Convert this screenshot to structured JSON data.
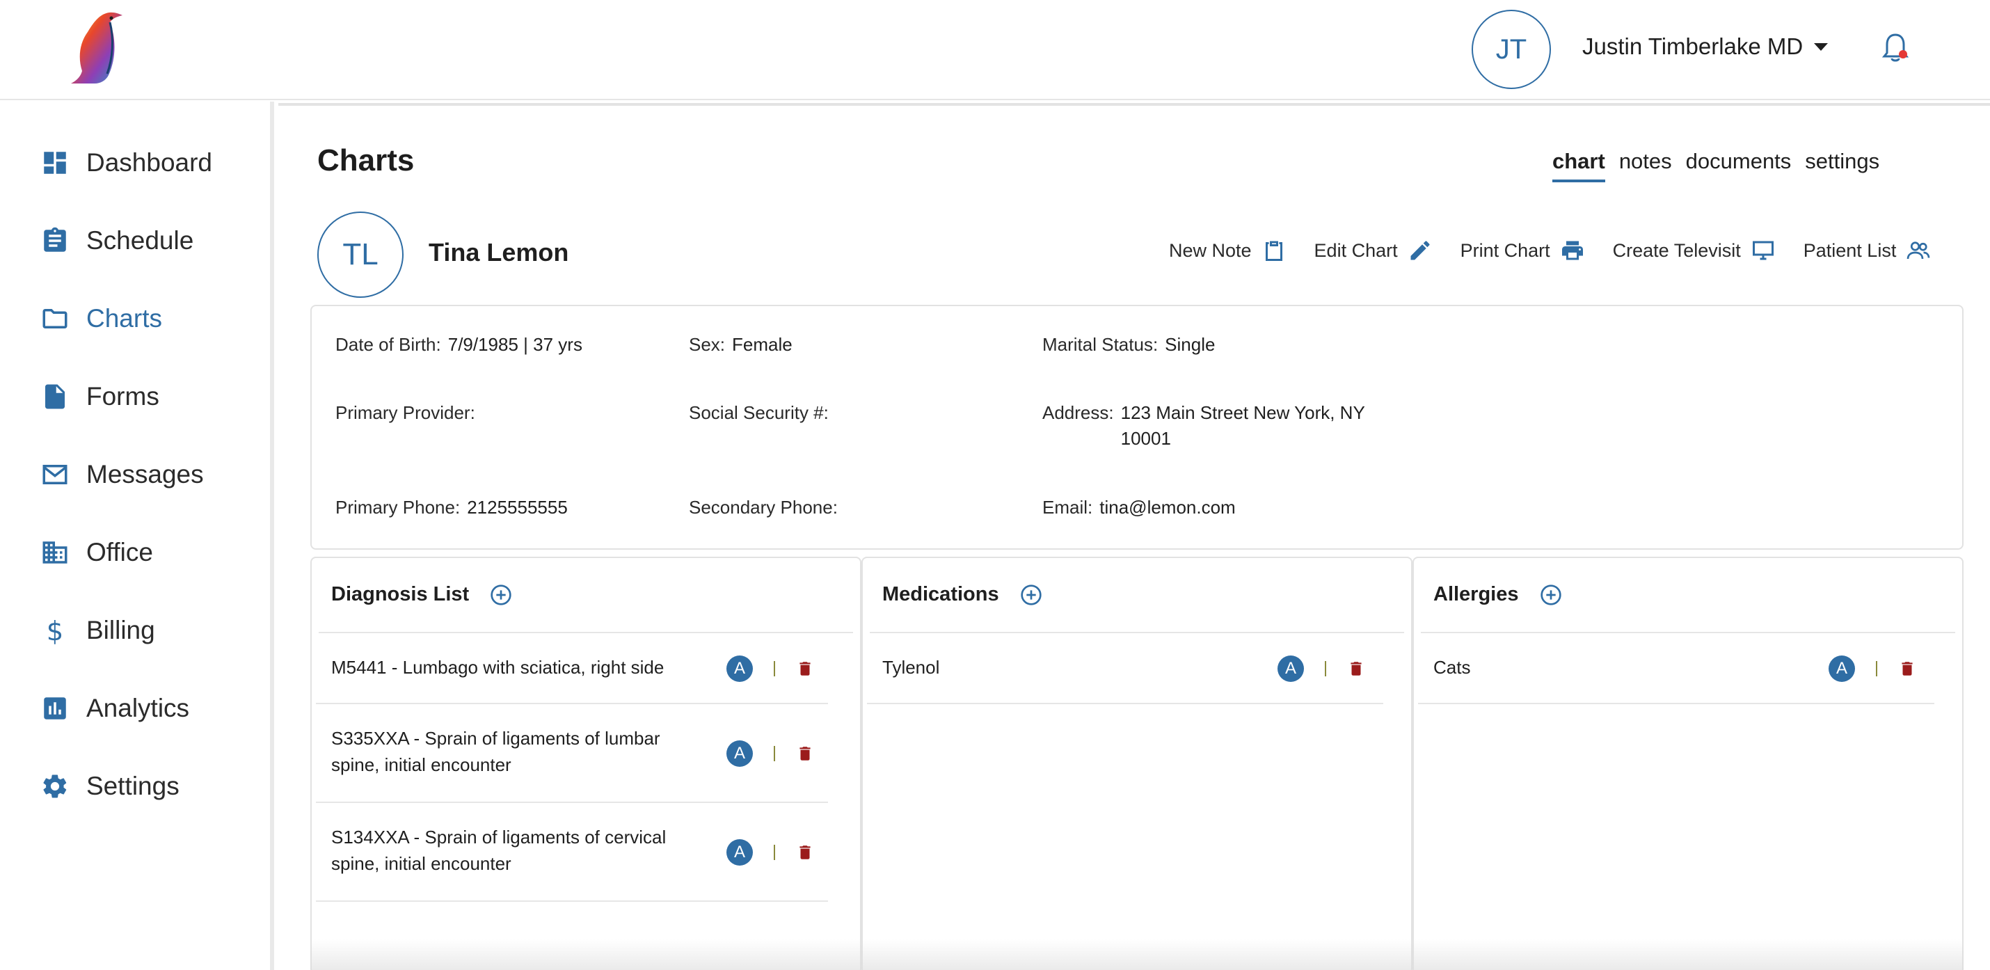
{
  "header": {
    "user_initials": "JT",
    "user_name": "Justin Timberlake MD"
  },
  "sidebar": {
    "items": [
      {
        "label": "Dashboard",
        "icon": "dashboard-icon"
      },
      {
        "label": "Schedule",
        "icon": "clipboard-icon"
      },
      {
        "label": "Charts",
        "icon": "folder-icon",
        "active": true
      },
      {
        "label": "Forms",
        "icon": "document-icon"
      },
      {
        "label": "Messages",
        "icon": "mail-icon"
      },
      {
        "label": "Office",
        "icon": "building-icon"
      },
      {
        "label": "Billing",
        "icon": "dollar-icon"
      },
      {
        "label": "Analytics",
        "icon": "bar-chart-icon"
      },
      {
        "label": "Settings",
        "icon": "gear-icon"
      }
    ]
  },
  "page": {
    "title": "Charts",
    "tabs": [
      "chart",
      "notes",
      "documents",
      "settings"
    ],
    "active_tab": "chart"
  },
  "patient": {
    "initials": "TL",
    "name": "Tina Lemon",
    "actions": [
      {
        "label": "New Note",
        "icon": "clipboard-icon"
      },
      {
        "label": "Edit Chart",
        "icon": "pencil-icon"
      },
      {
        "label": "Print Chart",
        "icon": "printer-icon"
      },
      {
        "label": "Create Televisit",
        "icon": "monitor-icon"
      },
      {
        "label": "Patient List",
        "icon": "people-icon"
      }
    ]
  },
  "demographics": {
    "dob_label": "Date of Birth:",
    "dob_value": "7/9/1985 | 37 yrs",
    "sex_label": "Sex:",
    "sex_value": "Female",
    "marital_label": "Marital Status:",
    "marital_value": "Single",
    "provider_label": "Primary Provider:",
    "provider_value": "",
    "ssn_label": "Social Security #:",
    "ssn_value": "",
    "address_label": "Address:",
    "address_line1": "123 Main Street New York, NY",
    "address_line2": "10001",
    "primary_phone_label": "Primary Phone:",
    "primary_phone_value": "2125555555",
    "secondary_phone_label": "Secondary Phone:",
    "secondary_phone_value": "",
    "email_label": "Email:",
    "email_value": "tina@lemon.com"
  },
  "lists": {
    "diagnosis": {
      "title": "Diagnosis List",
      "items": [
        {
          "line1": "M5441 - Lumbago with sciatica, right side",
          "line2": ""
        },
        {
          "line1": "S335XXA - Sprain of ligaments of lumbar",
          "line2": "spine, initial encounter"
        },
        {
          "line1": "S134XXA - Sprain of ligaments of cervical",
          "line2": "spine, initial encounter"
        }
      ]
    },
    "medications": {
      "title": "Medications",
      "items": [
        {
          "line1": "Tylenol"
        }
      ]
    },
    "allergies": {
      "title": "Allergies",
      "items": [
        {
          "line1": "Cats"
        }
      ]
    },
    "badge_letter": "A"
  },
  "colors": {
    "accent": "#2f6da4",
    "delete": "#9b1c1c",
    "notification_dot": "#e53935"
  }
}
